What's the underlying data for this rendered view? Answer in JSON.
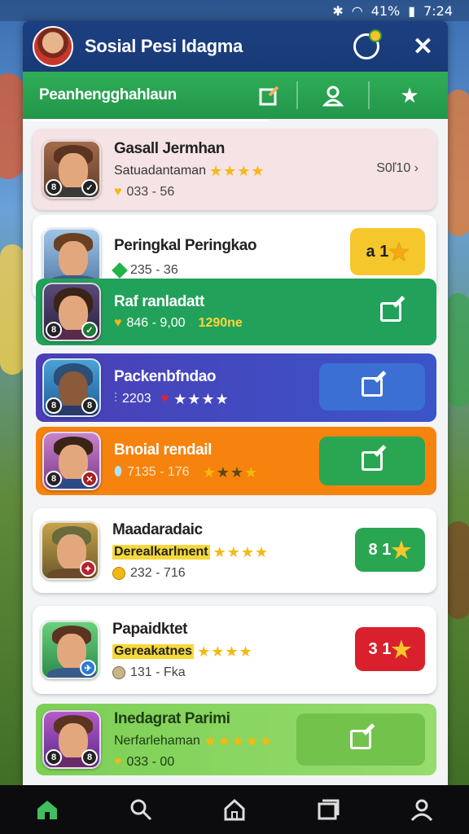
{
  "status": {
    "battery": "41%",
    "time": "7:24"
  },
  "header": {
    "title": "Sosial Pesi Idagma"
  },
  "subbar": {
    "title": "Peanhengghahlaun"
  },
  "entries": [
    {
      "name": "Gasall Jermhan",
      "subtitle": "Satuadantaman",
      "stat": "033 - 56",
      "right_text": "S0ľ10 ›",
      "stars": 4
    },
    {
      "name": "Peringkal Peringkao",
      "stat": "235 - 36",
      "action": "1",
      "action_prefix": "a"
    },
    {
      "name": "Raf ranladatt",
      "stat": "846 - 9,00",
      "stat_extra": "1290ne"
    },
    {
      "name": "Packenbfndao",
      "stat": "2203",
      "stars": 4
    },
    {
      "name": "Bnoial rendail",
      "stat": "7135 - 176",
      "stars": 3
    },
    {
      "name": "Maadaradaic",
      "subtitle": "Derealkarlment",
      "stat": "232 - 716",
      "action": "1",
      "action_prefix": "8",
      "stars": 4
    },
    {
      "name": "Papaidktet",
      "subtitle": "Gereakatnes",
      "stat": "131 - Fka",
      "action": "1",
      "action_prefix": "3",
      "stars": 4
    },
    {
      "name": "Inedagrat Parimi",
      "subtitle": "Nerfarlehaman",
      "stat": "033 - 00",
      "stars": 5
    }
  ],
  "colors": {
    "header": "#1c3f82",
    "subbar": "#2fae57",
    "row_green": "#22a15a",
    "row_purple": "#4b3fb7",
    "row_orange": "#f6830e",
    "row_lime": "#86d460",
    "gold": "#f5b90f",
    "red": "#d8212c"
  }
}
